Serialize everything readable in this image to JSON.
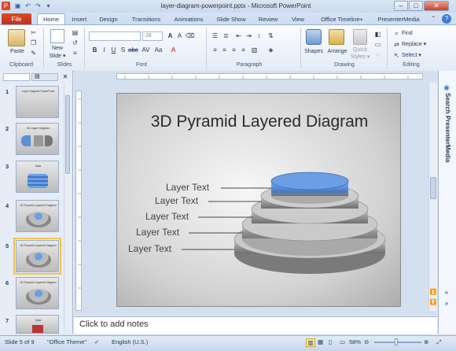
{
  "window": {
    "title": "layer-diagram-powerpoint.pptx - Microsoft PowerPoint"
  },
  "tabs": [
    "File",
    "Home",
    "Insert",
    "Design",
    "Transitions",
    "Animations",
    "Slide Show",
    "Review",
    "View",
    "Office Timeline+",
    "PresenterMedia"
  ],
  "ribbon": {
    "clipboard": {
      "label": "Clipboard",
      "paste": "Paste"
    },
    "slides": {
      "label": "Slides",
      "new_slide": "New",
      "new_slide2": "Slide ▾"
    },
    "font": {
      "label": "Font",
      "size": "28"
    },
    "paragraph": {
      "label": "Paragraph"
    },
    "drawing": {
      "label": "Drawing",
      "shapes": "Shapes",
      "arrange": "Arrange",
      "quick": "Quick",
      "styles": "Styles ▾"
    },
    "editing": {
      "label": "Editing",
      "find": "Find",
      "replace": "Replace ▾",
      "select": "Select ▾"
    }
  },
  "slides": [
    {
      "num": "1",
      "title": "Layer Diagram PowerPoint"
    },
    {
      "num": "2",
      "title": "3D Layer Diagram"
    },
    {
      "num": "3",
      "title": "Data"
    },
    {
      "num": "4",
      "title": "3D Pyramid Layered Diagram"
    },
    {
      "num": "5",
      "title": "3D Pyramid Layered Diagram"
    },
    {
      "num": "6",
      "title": "3D Pyramid Layered Diagram"
    },
    {
      "num": "7",
      "title": "Data"
    }
  ],
  "slide": {
    "title": "3D Pyramid Layered Diagram",
    "layers": [
      "Layer Text",
      "Layer Text",
      "Layer Text",
      "Layer Text",
      "Layer Text"
    ]
  },
  "sidebar": {
    "label": "Search PresenterMedia"
  },
  "notes": {
    "placeholder": "Click to add notes"
  },
  "status": {
    "slide": "Slide 5 of 9",
    "theme": "\"Office Theme\"",
    "language": "English (U.S.)",
    "zoom": "58%"
  },
  "colors": {
    "accent_file": "#c4401f",
    "layer_top": "#5b8fd6"
  }
}
